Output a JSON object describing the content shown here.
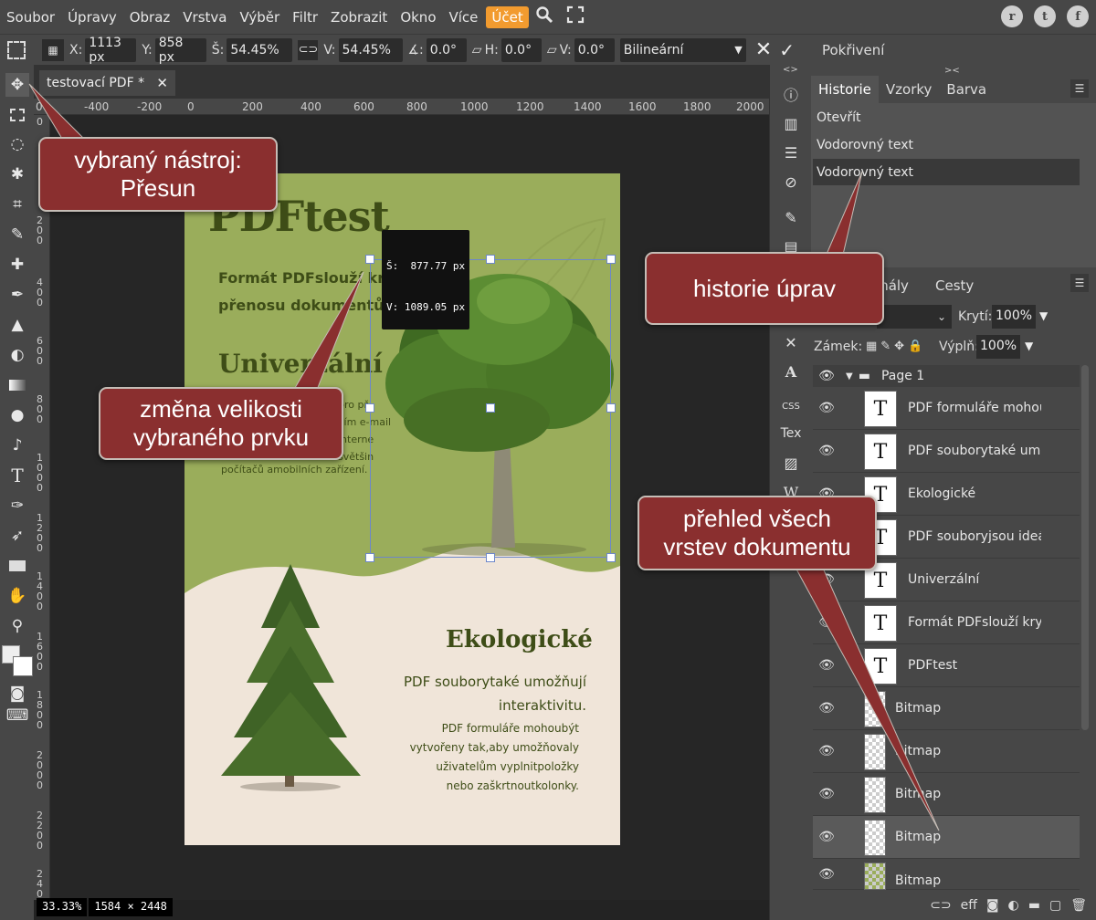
{
  "menubar": {
    "items": [
      "Soubor",
      "Úpravy",
      "Obraz",
      "Vrstva",
      "Výběr",
      "Filtr",
      "Zobrazit",
      "Okno",
      "Více"
    ],
    "account": "Účet",
    "icons": [
      "search-icon",
      "fullscreen-icon"
    ],
    "social": [
      "reddit-icon",
      "twitter-icon",
      "facebook-icon"
    ]
  },
  "options": {
    "x_label": "X:",
    "x": "1113 px",
    "y_label": "Y:",
    "y": "858 px",
    "w_label": "Š:",
    "w": "54.45%",
    "h_label": "V:",
    "h": "54.45%",
    "angle_label": "∡:",
    "angle": "0.0°",
    "skew_h_label": "H:",
    "skew_h": "0.0°",
    "skew_v_label": "V:",
    "skew_v": "0.0°",
    "interp": "Bilineární",
    "warp": "Pokřivení"
  },
  "document": {
    "tab": "testovací PDF *",
    "ruler_top": [
      "00",
      "-400",
      "-200",
      "0",
      "200",
      "400",
      "600",
      "800",
      "1000",
      "1200",
      "1400",
      "1600",
      "1800",
      "2000"
    ],
    "ruler_left": [
      "0",
      "2 0 0",
      "4 0 0",
      "6 0 0",
      "8 0 0",
      "1 0 0 0",
      "1 2 0 0",
      "1 4 0 0",
      "1 6 0 0",
      "1 8 0 0",
      "2 0 0 0",
      "2 2 0 0",
      "2 4 0 0"
    ],
    "zoom": "33.33%",
    "size": "1584 × 2448",
    "tooltip_w": "Š:  877.77 px",
    "tooltip_h": "V: 1089.05 px"
  },
  "page": {
    "title": "PDFtest",
    "intro_line1": "Formát PDFslouží krychlému",
    "intro_line2": "přenosu dokumentů.",
    "heading2": "Univerzální",
    "body2_lines": [
      "pro př",
      "vím e-mail",
      "interne",
      "světšin"
    ],
    "body2_last": "počítačů amobilních zařízení.",
    "eco_title": "Ekologické",
    "eco_line1": "PDF souborytaké umožňují",
    "eco_line2": "interaktivitu.",
    "form_lines": [
      "PDF formuláře mohoubýt",
      "vytvořeny tak,aby umožňovaly",
      "uživatelům vyplnitpoložky",
      "nebo zaškrtnoutkolonky."
    ]
  },
  "history": {
    "tabs": [
      "Historie",
      "Vzorky",
      "Barva"
    ],
    "items": [
      "Otevřít",
      "Vodorovný text",
      "Vodorovný text"
    ]
  },
  "layers": {
    "tabs_visible": [
      "anály",
      "Cesty"
    ],
    "opacity_label": "Krytí:",
    "opacity": "100%",
    "lock_label": "Zámek:",
    "fill_label": "Výplň:",
    "fill": "100%",
    "group": "Page 1",
    "rows": [
      {
        "name": "PDF formuláře mohou",
        "type": "T"
      },
      {
        "name": "PDF souborytaké umo",
        "type": "T"
      },
      {
        "name": "Ekologické",
        "type": "T"
      },
      {
        "name": "PDF souboryjsou ideá",
        "type": "T"
      },
      {
        "name": "Univerzální",
        "type": "T"
      },
      {
        "name": "Formát PDFslouží kryc",
        "type": "T"
      },
      {
        "name": "PDFtest",
        "type": "T"
      },
      {
        "name": "Bitmap",
        "type": "B"
      },
      {
        "name": "Bitmap",
        "type": "B"
      },
      {
        "name": "Bitmap",
        "type": "B"
      },
      {
        "name": "Bitmap",
        "type": "B"
      },
      {
        "name": "Bitmap",
        "type": "B"
      }
    ],
    "footer_text": "eff"
  },
  "right_icons_text": {
    "css": "CSS",
    "tex": "Tex"
  },
  "callouts": {
    "tool": "vybraný nástroj:\nPřesun",
    "history": "historie úprav",
    "resize": "změna velikosti\nvybraného prvku",
    "layers": "přehled všech\nvrstev dokumentu"
  },
  "colors": {
    "accent": "#f29b2f",
    "callout": "#8a2f2f",
    "page_green": "#9aad5b",
    "page_cream": "#f0e5d9",
    "title_green": "#3e4d17"
  }
}
